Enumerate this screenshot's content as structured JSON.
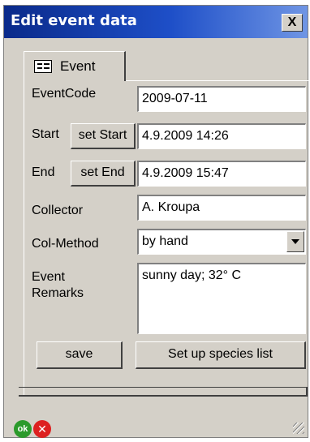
{
  "window": {
    "title": "Edit event data",
    "close_glyph": "X"
  },
  "tab": {
    "label": "Event",
    "icon": "form-icon"
  },
  "form": {
    "event_code_label": "EventCode",
    "event_code_value": "2009-07-11",
    "start_label": "Start",
    "set_start_label": "set Start",
    "start_value": "4.9.2009 14:26",
    "end_label": "End",
    "set_end_label": "set End",
    "end_value": "4.9.2009 15:47",
    "collector_label": "Collector",
    "collector_value": "A. Kroupa",
    "col_method_label": "Col-Method",
    "col_method_value": "by hand",
    "remarks_label_line1": "Event",
    "remarks_label_line2": "Remarks",
    "remarks_value": "sunny day; 32° C"
  },
  "buttons": {
    "save_label": "save",
    "species_label": "Set up species list"
  },
  "footer": {
    "ok_label": "ok",
    "cancel_glyph": "✕"
  },
  "colors": {
    "title_bar": "#0a2a8a",
    "window_bg": "#d4d0c8",
    "ok_green": "#2b9a2b",
    "cancel_red": "#dd2020"
  }
}
